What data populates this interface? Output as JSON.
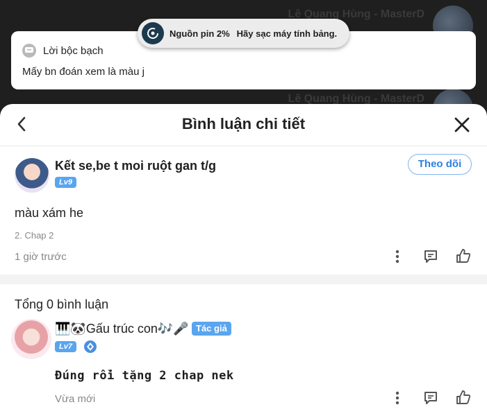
{
  "background": {
    "user_name_1": "Lê Quang Hùng - MasterD",
    "user_name_2": "Lê Quang Hùng - MasterD"
  },
  "toast": {
    "title": "Nguồn pin 2%",
    "message": "Hãy sạc máy tính bảng."
  },
  "notification": {
    "title": "Lời bộc bạch",
    "body": "Mấy bn đoán xem là màu j"
  },
  "sheet": {
    "title": "Bình luận chi tiết"
  },
  "main_comment": {
    "user": "Kết se,be t moi ruột gan t/g",
    "level": "Lv9",
    "follow_label": "Theo dõi",
    "text": "màu xám he",
    "chapter": "2. Chap 2",
    "time": "1 giờ trước"
  },
  "replies": {
    "total_label": "Tổng 0 bình luận",
    "items": [
      {
        "user": "🎹🐼Gấu trúc con🎶🎤",
        "badge": "Tác giả",
        "level": "Lv7",
        "text": "Đúng rồi tặng 2 chap nek",
        "time": "Vừa mới"
      }
    ]
  },
  "colors": {
    "accent": "#5aa5ef",
    "follow": "#2d7fe0",
    "toast_icon": "#1b3a4e"
  }
}
